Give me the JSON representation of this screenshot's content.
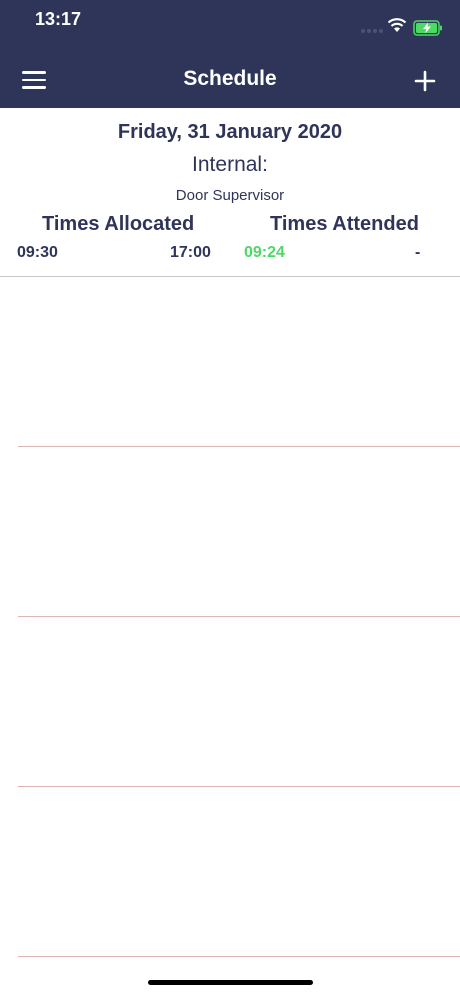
{
  "status_bar": {
    "time": "13:17"
  },
  "header": {
    "title": "Schedule",
    "menu_icon": "hamburger-menu-icon",
    "add_icon": "plus-icon"
  },
  "schedule": {
    "date": "Friday, 31 January 2020",
    "type": "Internal:",
    "role": "Door Supervisor",
    "allocated_label": "Times Allocated",
    "attended_label": "Times Attended",
    "allocated_start": "09:30",
    "allocated_end": "17:00",
    "attended_start": "09:24",
    "attended_end": "-"
  },
  "colors": {
    "header_bg": "#2e3559",
    "attended_green": "#4cd964",
    "battery_green": "#4cd964"
  }
}
